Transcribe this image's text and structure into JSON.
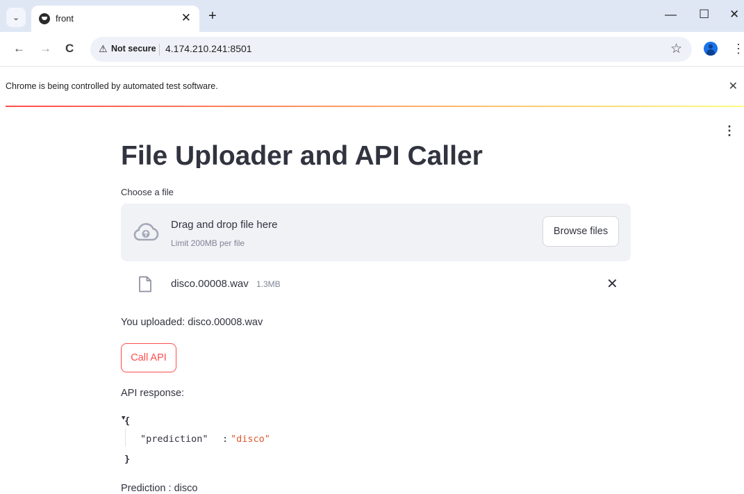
{
  "browser": {
    "tab_title": "front",
    "tab_close": "✕",
    "new_tab": "+",
    "tab_list_icon": "chevron-down-icon",
    "window": {
      "minimize": "—",
      "maximize": "☐",
      "close": "✕"
    },
    "nav": {
      "back": "←",
      "forward": "→",
      "reload": "C"
    },
    "security": {
      "icon": "⚠",
      "label": "Not secure"
    },
    "url": "4.174.210.241:8501",
    "bookmark": "☆",
    "menu": "⋮",
    "infobar": {
      "text": "Chrome is being controlled by automated test software.",
      "close": "✕"
    }
  },
  "app": {
    "menu": "⋮",
    "title": "File Uploader and API Caller",
    "uploader": {
      "label": "Choose a file",
      "drag_text": "Drag and drop file here",
      "limit_text": "Limit 200MB per file",
      "browse_label": "Browse files",
      "file_name": "disco.00008.wav",
      "file_size": "1.3MB",
      "remove": "✕"
    },
    "uploaded_text": "You uploaded: disco.00008.wav",
    "call_button": "Call API",
    "response_label": "API response:",
    "json": {
      "toggle": "▼",
      "open": "{",
      "key": "\"prediction\"",
      "colon": ":",
      "value": "\"disco\"",
      "close": "}"
    },
    "prediction_text": "Prediction : disco"
  },
  "colors": {
    "primary": "#ff4b4b",
    "text": "#31333f",
    "muted": "#808495",
    "dropzone_bg": "#f0f2f6",
    "tabstrip_bg": "#dfe7f5",
    "json_string": "#e0572e"
  }
}
